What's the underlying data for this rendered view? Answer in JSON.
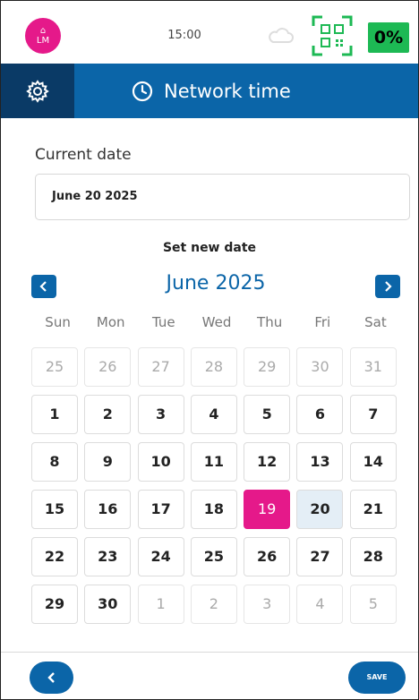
{
  "status_bar": {
    "avatar_initials": "LM",
    "time": "15:00",
    "battery": "0%",
    "icons": [
      "user-icon",
      "cloud-icon",
      "qr-code-icon"
    ],
    "colors": {
      "avatar": "#e5198a",
      "battery": "#1db954",
      "qr": "#1db954"
    }
  },
  "header": {
    "title": "Network time",
    "icons": [
      "gear-icon",
      "clock-icon"
    ],
    "colors": {
      "bar": "#0b65a8",
      "settings": "#0a3a66"
    }
  },
  "current_date": {
    "label": "Current date",
    "value": "June 20 2025"
  },
  "set_new_date": {
    "label": "Set new date"
  },
  "calendar": {
    "month_label": "June 2025",
    "weekdays": [
      "Sun",
      "Mon",
      "Tue",
      "Wed",
      "Thu",
      "Fri",
      "Sat"
    ],
    "days": [
      {
        "n": "25",
        "muted": true
      },
      {
        "n": "26",
        "muted": true
      },
      {
        "n": "27",
        "muted": true
      },
      {
        "n": "28",
        "muted": true
      },
      {
        "n": "29",
        "muted": true
      },
      {
        "n": "30",
        "muted": true
      },
      {
        "n": "31",
        "muted": true
      },
      {
        "n": "1"
      },
      {
        "n": "2"
      },
      {
        "n": "3"
      },
      {
        "n": "4"
      },
      {
        "n": "5"
      },
      {
        "n": "6"
      },
      {
        "n": "7"
      },
      {
        "n": "8"
      },
      {
        "n": "9"
      },
      {
        "n": "10"
      },
      {
        "n": "11"
      },
      {
        "n": "12"
      },
      {
        "n": "13"
      },
      {
        "n": "14"
      },
      {
        "n": "15"
      },
      {
        "n": "16"
      },
      {
        "n": "17"
      },
      {
        "n": "18"
      },
      {
        "n": "19",
        "selected": true
      },
      {
        "n": "20",
        "today": true
      },
      {
        "n": "21"
      },
      {
        "n": "22"
      },
      {
        "n": "23"
      },
      {
        "n": "24"
      },
      {
        "n": "25"
      },
      {
        "n": "26"
      },
      {
        "n": "27"
      },
      {
        "n": "28"
      },
      {
        "n": "29"
      },
      {
        "n": "30"
      },
      {
        "n": "1",
        "muted": true
      },
      {
        "n": "2",
        "muted": true
      },
      {
        "n": "3",
        "muted": true
      },
      {
        "n": "4",
        "muted": true
      },
      {
        "n": "5",
        "muted": true
      }
    ],
    "colors": {
      "selected": "#e5198a",
      "today": "#e4eef6",
      "accent": "#0b65a8"
    },
    "nav_icons": [
      "chevron-left-icon",
      "chevron-right-icon"
    ]
  },
  "footer": {
    "save_label": "SAVE",
    "back_icon": "chevron-left-icon"
  }
}
